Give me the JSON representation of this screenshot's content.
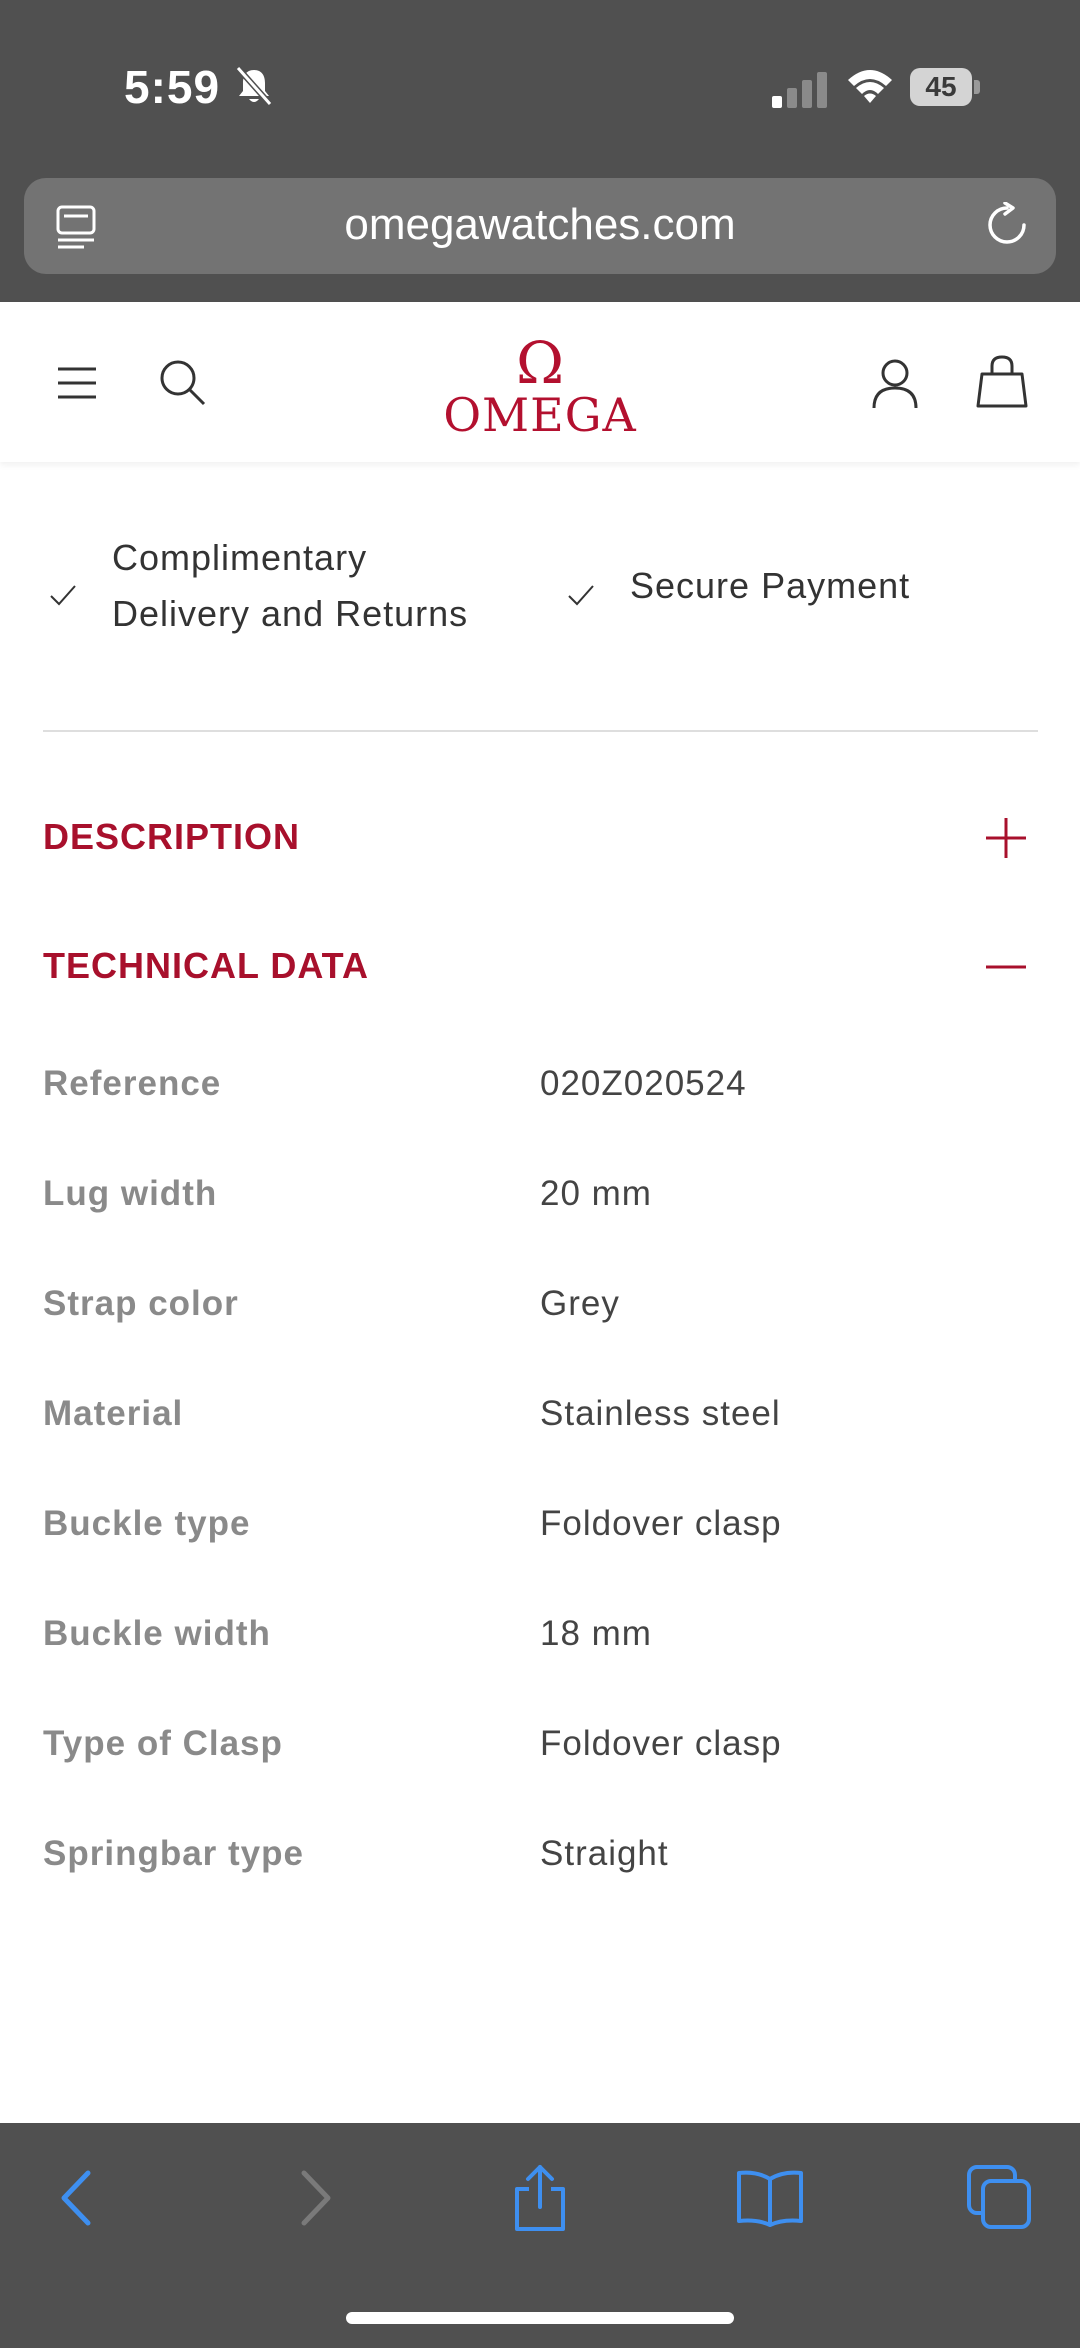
{
  "status_bar": {
    "time": "5:59",
    "battery": "45"
  },
  "browser": {
    "url": "omegawatches.com"
  },
  "brand": {
    "symbol": "Ω",
    "name": "OMEGA",
    "accent_color": "#b3102f"
  },
  "header": {
    "icons": [
      "menu-icon",
      "search-icon",
      "account-icon",
      "shopping-bag-icon"
    ]
  },
  "benefits": [
    {
      "line1": "Complimentary",
      "line2": "Delivery and Returns"
    },
    {
      "line1": "Secure Payment"
    }
  ],
  "sections": {
    "description": {
      "title": "DESCRIPTION",
      "state": "collapsed",
      "toggle_icon": "plus-icon"
    },
    "technical_data": {
      "title": "TECHNICAL DATA",
      "state": "expanded",
      "toggle_icon": "minus-icon"
    }
  },
  "specs": [
    {
      "label": "Reference",
      "value": "020Z020524"
    },
    {
      "label": "Lug width",
      "value": "20 mm"
    },
    {
      "label": "Strap color",
      "value": "Grey"
    },
    {
      "label": "Material",
      "value": "Stainless steel"
    },
    {
      "label": "Buckle type",
      "value": "Foldover clasp"
    },
    {
      "label": "Buckle width",
      "value": "18 mm"
    },
    {
      "label": "Type of Clasp",
      "value": "Foldover clasp"
    },
    {
      "label": "Springbar type",
      "value": "Straight"
    }
  ],
  "toolbar": {
    "icons": [
      "back-icon",
      "forward-icon",
      "share-icon",
      "bookmarks-icon",
      "tabs-icon"
    ]
  }
}
